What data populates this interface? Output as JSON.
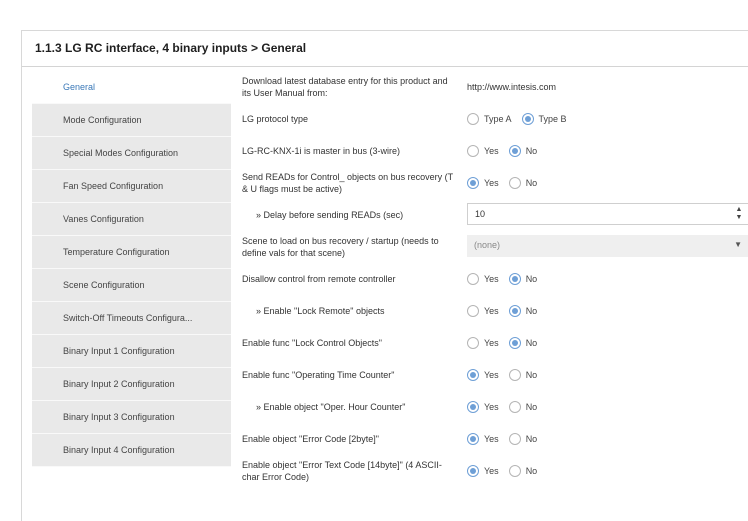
{
  "window": {
    "title": "1.1.3 LG RC interface, 4 binary inputs > General"
  },
  "sidebar": {
    "items": [
      {
        "label": "General",
        "active": true
      },
      {
        "label": "Mode Configuration",
        "active": false
      },
      {
        "label": "Special Modes Configuration",
        "active": false
      },
      {
        "label": "Fan Speed Configuration",
        "active": false
      },
      {
        "label": "Vanes Configuration",
        "active": false
      },
      {
        "label": "Temperature Configuration",
        "active": false
      },
      {
        "label": "Scene Configuration",
        "active": false
      },
      {
        "label": "Switch-Off Timeouts Configura...",
        "active": false
      },
      {
        "label": "Binary Input 1 Configuration",
        "active": false
      },
      {
        "label": "Binary Input 2 Configuration",
        "active": false
      },
      {
        "label": "Binary Input 3 Configuration",
        "active": false
      },
      {
        "label": "Binary Input 4 Configuration",
        "active": false
      }
    ]
  },
  "settings": {
    "download": {
      "label": "Download latest database entry for this product and its User Manual from:",
      "value": "http://www.intesis.com"
    },
    "protocol": {
      "label": "LG protocol type",
      "options": [
        "Type A",
        "Type B"
      ],
      "selected": 1
    },
    "master": {
      "label": "LG-RC-KNX-1i is master in bus (3-wire)",
      "options": [
        "Yes",
        "No"
      ],
      "selected": 1
    },
    "send_reads": {
      "label": "Send READs for Control_ objects on bus recovery (T & U flags must be active)",
      "options": [
        "Yes",
        "No"
      ],
      "selected": 0
    },
    "delay": {
      "label": "» Delay before sending READs (sec)",
      "value": "10",
      "up_arrow": "▲",
      "down_arrow": "▼"
    },
    "scene": {
      "label": "Scene to load on bus recovery / startup (needs to define vals for that scene)",
      "value": "(none)",
      "arrow": "▼"
    },
    "disallow_remote": {
      "label": "Disallow control from remote controller",
      "options": [
        "Yes",
        "No"
      ],
      "selected": 1
    },
    "lock_remote": {
      "label": "» Enable \"Lock Remote\" objects",
      "options": [
        "Yes",
        "No"
      ],
      "selected": 1
    },
    "lock_control": {
      "label": "Enable func \"Lock Control Objects\"",
      "options": [
        "Yes",
        "No"
      ],
      "selected": 1
    },
    "operating_time": {
      "label": "Enable func \"Operating Time Counter\"",
      "options": [
        "Yes",
        "No"
      ],
      "selected": 0
    },
    "oper_hour": {
      "label": "» Enable object \"Oper. Hour Counter\"",
      "options": [
        "Yes",
        "No"
      ],
      "selected": 0
    },
    "error_code": {
      "label": "Enable object \"Error Code [2byte]\"",
      "options": [
        "Yes",
        "No"
      ],
      "selected": 0
    },
    "error_text": {
      "label": "Enable object \"Error Text Code [14byte]\" (4 ASCII-char Error Code)",
      "options": [
        "Yes",
        "No"
      ],
      "selected": 0
    }
  },
  "colors": {
    "accent": "#3a78b8",
    "radio_selected": "#6e9fd6",
    "sidebar_bg": "#e9e9e9"
  }
}
